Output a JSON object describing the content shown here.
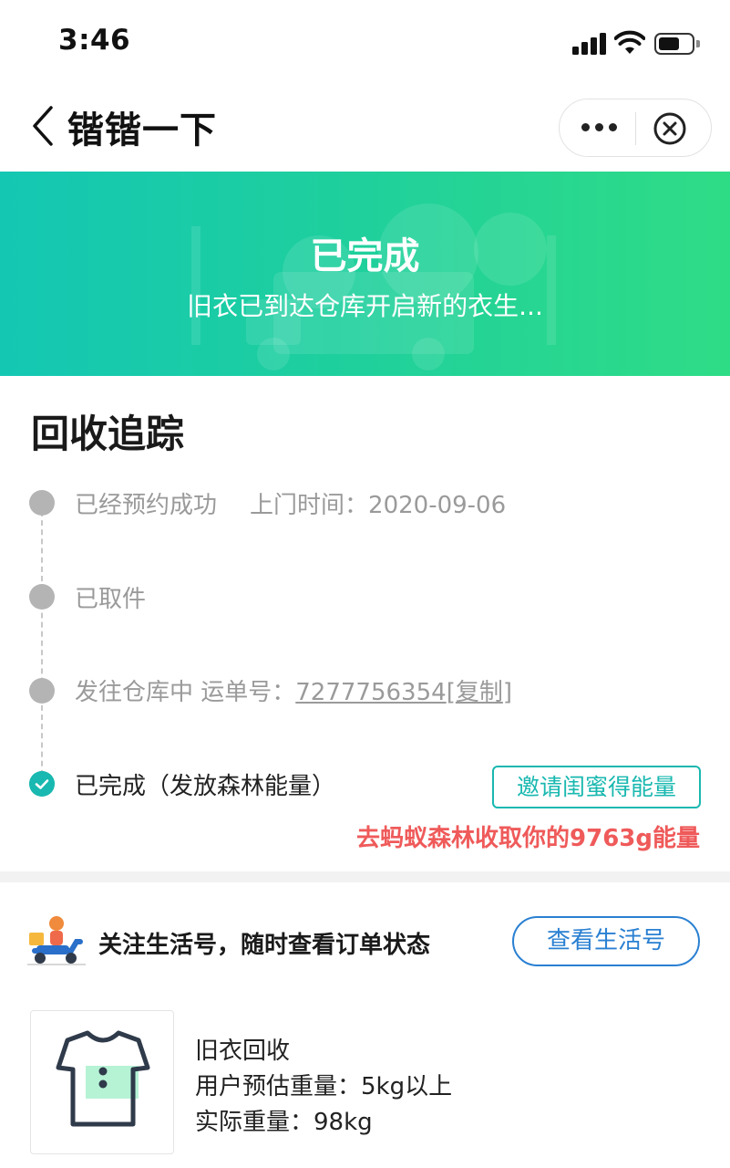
{
  "status_bar": {
    "time": "3:46"
  },
  "nav": {
    "title": "锴锴一下",
    "icons": [
      "back-chevron-icon",
      "more-dots-icon",
      "close-circle-icon"
    ]
  },
  "banner": {
    "title": "已完成",
    "subtitle": "旧衣已到达仓库开启新的衣生...",
    "gradient_start": "#14c7b3",
    "gradient_end": "#2fdc86"
  },
  "tracking": {
    "title": "回收追踪",
    "steps": [
      {
        "label": "已经预约成功",
        "detail_label": "上门时间：",
        "detail_value": "2020-09-06",
        "state": "done"
      },
      {
        "label": "已取件",
        "state": "done"
      },
      {
        "label": "发往仓库中 运单号：",
        "tracking_no": "7277756354",
        "copy_open": "[",
        "copy_label": "复制",
        "copy_close": "]",
        "state": "done"
      },
      {
        "label": "已完成（发放森林能量）",
        "state": "current"
      }
    ],
    "invite_button": "邀请闺蜜得能量",
    "forest_link": "去蚂蚁森林收取你的9763g能量",
    "accent_color": "#19b8b0",
    "highlight_color": "#ef5a5a"
  },
  "follow": {
    "text": "关注生活号，随时查看订单状态",
    "button": "查看生活号",
    "button_color": "#2a80d2",
    "illustration": "courier-scooter-icon"
  },
  "product": {
    "icon": "tshirt-icon",
    "name": "旧衣回收",
    "estimated_label": "用户预估重量：",
    "estimated_value": "5kg以上",
    "actual_label": "实际重量：",
    "actual_value": "98kg"
  }
}
